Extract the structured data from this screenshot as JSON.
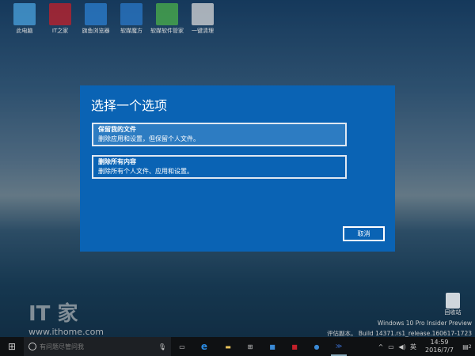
{
  "desktop": {
    "icons": [
      {
        "label": "此电脑",
        "color": "#4aa3df"
      },
      {
        "label": "IT之家",
        "color": "#c3202a"
      },
      {
        "label": "旗鱼浏览器",
        "color": "#2b7fd0"
      },
      {
        "label": "软媒魔方",
        "color": "#2a78c8"
      },
      {
        "label": "软媒软件管家",
        "color": "#4bb04a"
      },
      {
        "label": "一键清理",
        "color": "#d8d8d8"
      }
    ],
    "recycle_bin": "回收站",
    "watermark_site": "www.ithome.com",
    "watermark_logo": "IT之家",
    "build_line1": "Windows 10 Pro Insider Preview",
    "build_line2": "评估副本。 Build 14371.rs1_release.160617-1723"
  },
  "dialog": {
    "title": "选择一个选项",
    "options": [
      {
        "title": "保留我的文件",
        "desc": "删除应用和设置，但保留个人文件。"
      },
      {
        "title": "删除所有内容",
        "desc": "删除所有个人文件、应用和设置。"
      }
    ],
    "cancel": "取消",
    "accent": "#0a63b4"
  },
  "taskbar": {
    "search_placeholder": "有问题尽管问我",
    "time": "14:59",
    "date": "2016/7/7",
    "ime": "英",
    "notifications": "2"
  }
}
